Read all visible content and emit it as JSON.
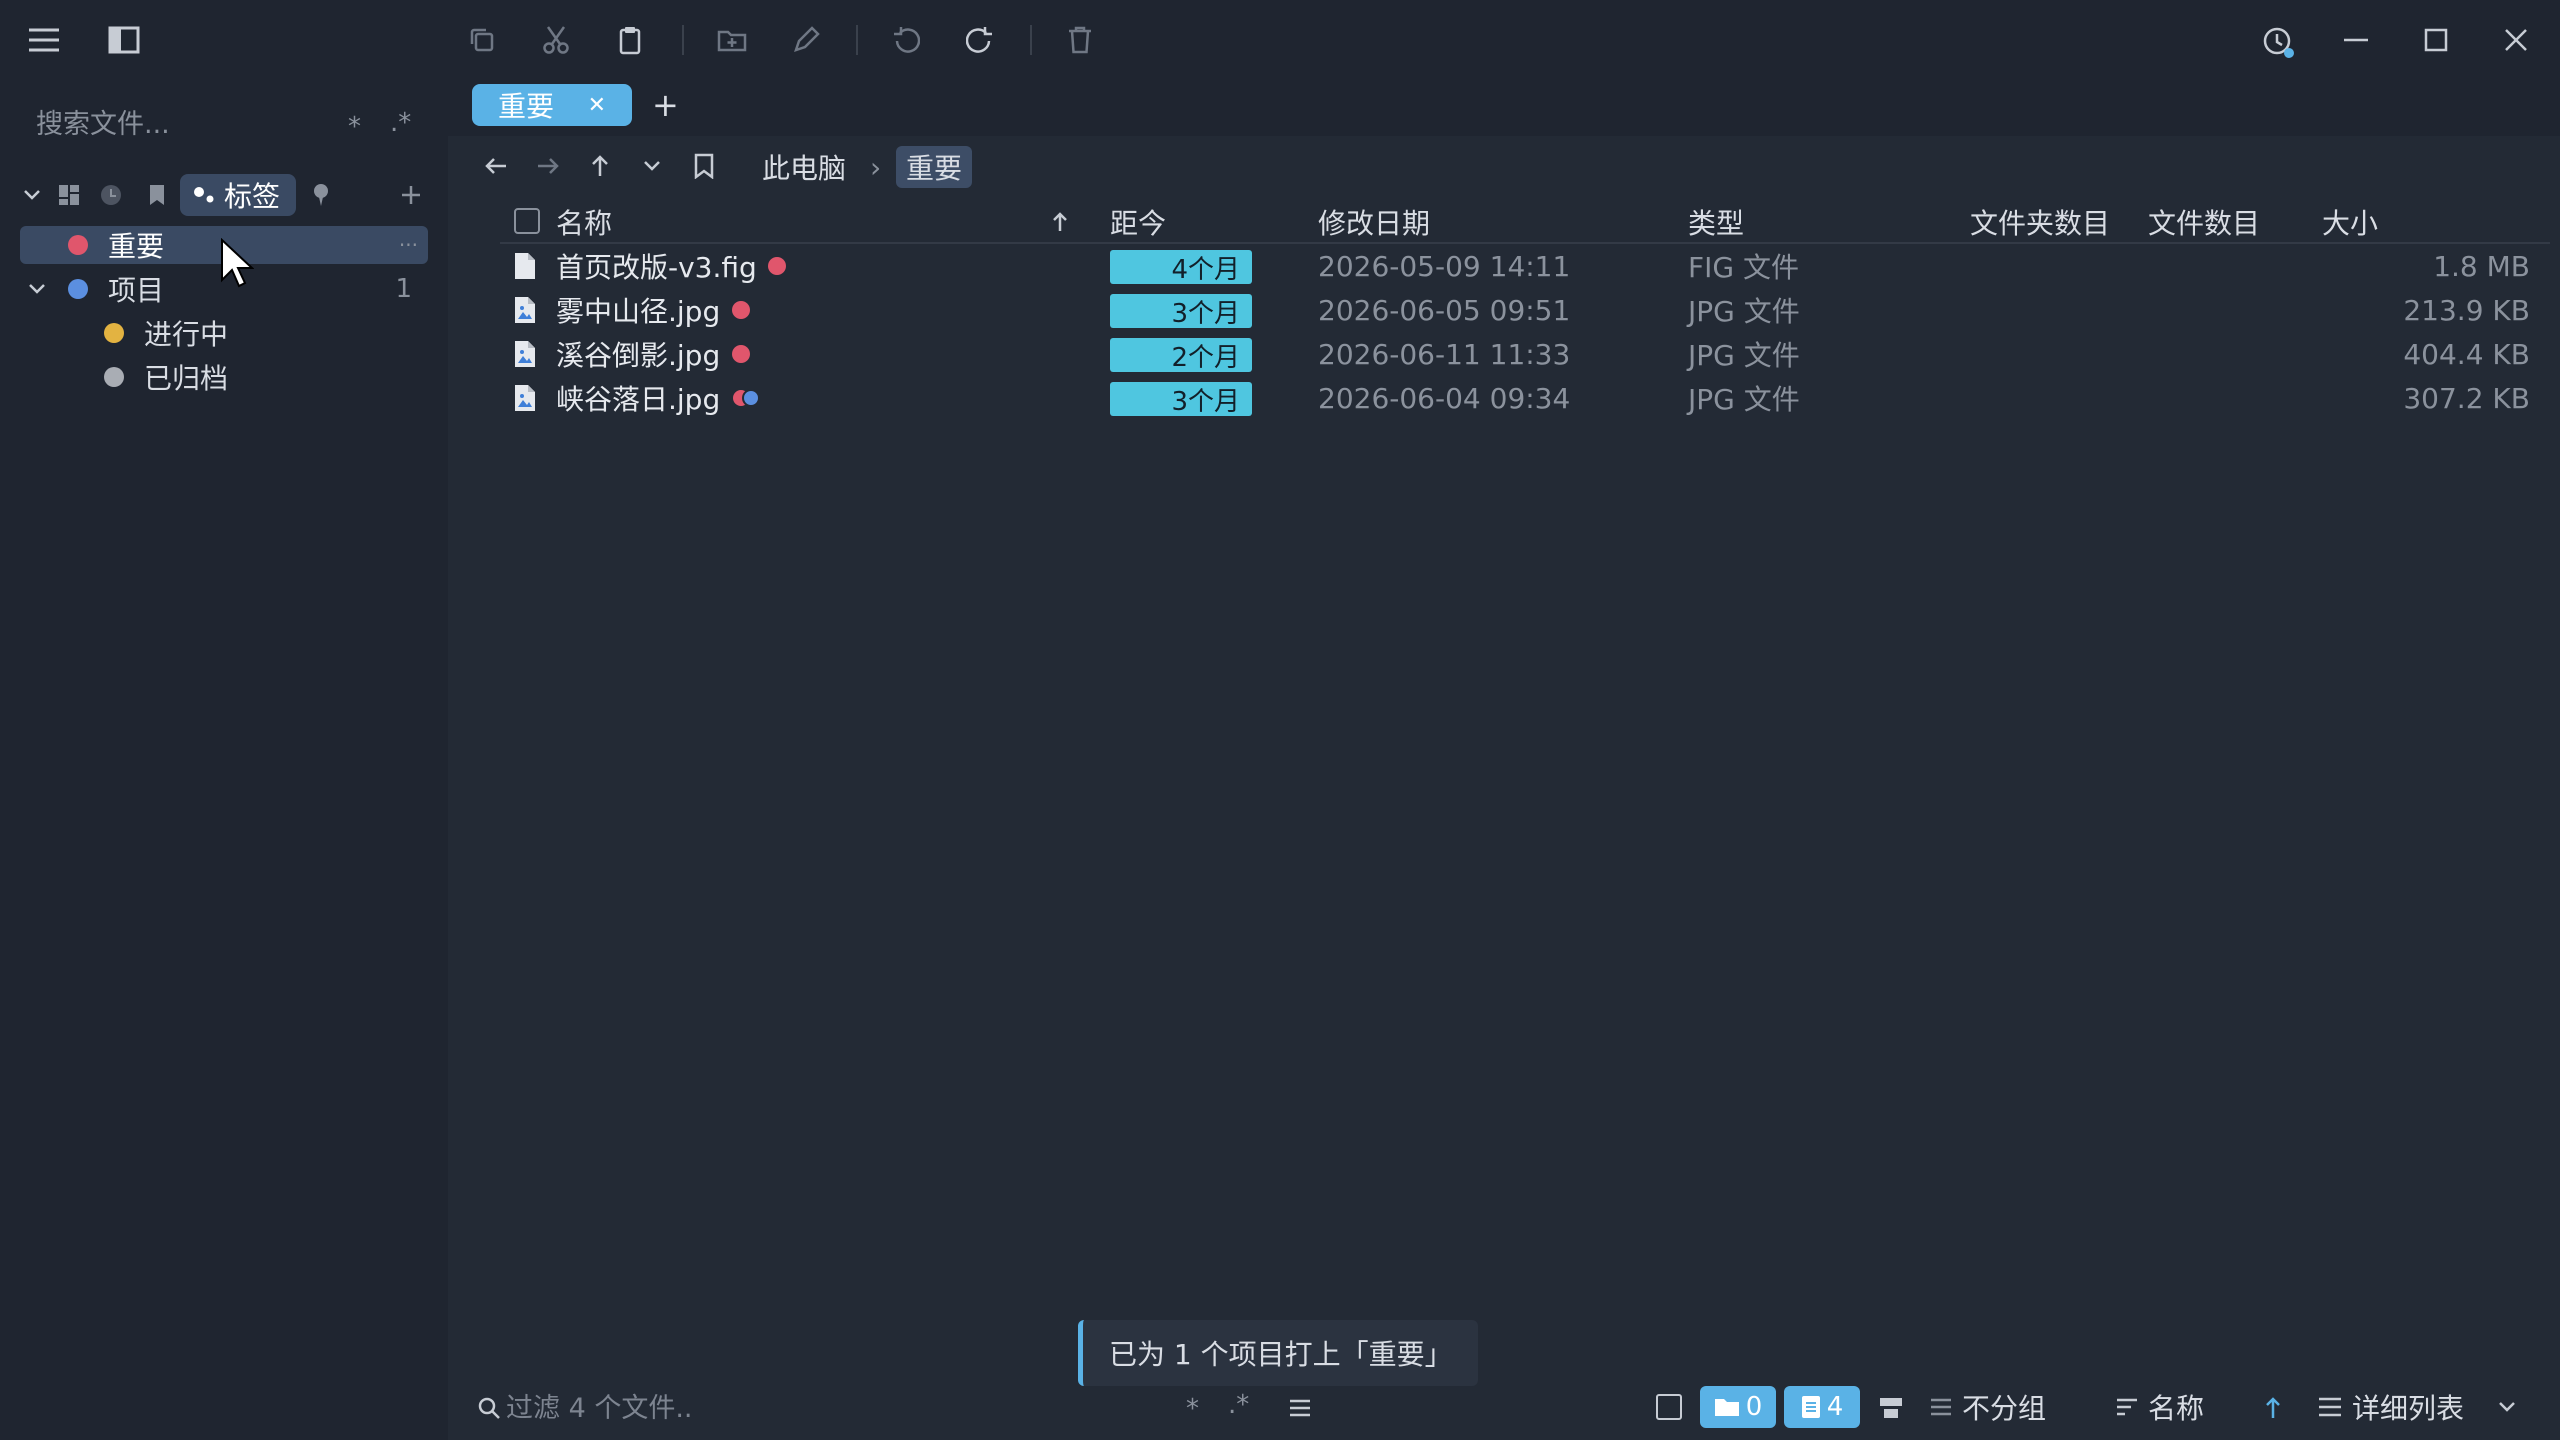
{
  "toolbar": {
    "icons": [
      "menu-icon",
      "sidebar-toggle-icon",
      "copy-icon",
      "cut-icon",
      "paste-icon",
      "new-folder-icon",
      "rename-icon",
      "undo-icon",
      "redo-icon",
      "delete-icon",
      "history-icon",
      "minimize-icon",
      "maximize-icon",
      "close-icon"
    ]
  },
  "sidebar": {
    "search_placeholder": "搜索文件...",
    "glob_symbol": "*",
    "regex_symbol": ".*",
    "view_tabs": {
      "active_label": "标签"
    },
    "tags": [
      {
        "label": "重要",
        "color": "#e0566c",
        "count": "",
        "more": "···"
      },
      {
        "label": "项目",
        "color": "#5b8fe0",
        "count": "1"
      },
      {
        "label": "进行中",
        "color": "#e3b341"
      },
      {
        "label": "已归档",
        "color": "#a9adb4"
      }
    ]
  },
  "tabs": [
    {
      "label": "重要",
      "close": "✕"
    }
  ],
  "tab_add": "+",
  "breadcrumb": {
    "root": "此电脑",
    "separator": "›",
    "current": "重要"
  },
  "table": {
    "headers": {
      "name": "名称",
      "age": "距今",
      "modified": "修改日期",
      "type": "类型",
      "folder_count": "文件夹数目",
      "file_count": "文件数目",
      "size": "大小"
    },
    "rows": [
      {
        "name": "首页改版-v3.fig",
        "age": "4个月",
        "modified": "2026-05-09 14:11",
        "type": "FIG 文件",
        "size": "1.8 MB",
        "icon": "file-icon",
        "tags": [
          "#e0566c"
        ]
      },
      {
        "name": "雾中山径.jpg",
        "age": "3个月",
        "modified": "2026-06-05 09:51",
        "type": "JPG 文件",
        "size": "213.9 KB",
        "icon": "image-file-icon",
        "tags": [
          "#e0566c"
        ]
      },
      {
        "name": "溪谷倒影.jpg",
        "age": "2个月",
        "modified": "2026-06-11 11:33",
        "type": "JPG 文件",
        "size": "404.4 KB",
        "icon": "image-file-icon",
        "tags": [
          "#e0566c"
        ]
      },
      {
        "name": "峡谷落日.jpg",
        "age": "3个月",
        "modified": "2026-06-04 09:34",
        "type": "JPG 文件",
        "size": "307.2 KB",
        "icon": "image-file-icon",
        "tags": [
          "#e0566c",
          "#5b8fe0"
        ]
      }
    ]
  },
  "toast": {
    "message": "已为 1 个项目打上「重要」"
  },
  "statusbar": {
    "filter_placeholder": "过滤 4 个文件..",
    "glob_symbol": "*",
    "regex_symbol": ".*",
    "folder_count": "0",
    "file_count": "4",
    "group_label": "不分组",
    "sort_label": "名称",
    "view_label": "详细列表"
  },
  "colors": {
    "accent": "#5ab2e6",
    "age_badge": "#4fc6e0",
    "tag_red": "#e0566c",
    "tag_blue": "#5b8fe0",
    "tag_yellow": "#e3b341",
    "tag_gray": "#a9adb4"
  }
}
